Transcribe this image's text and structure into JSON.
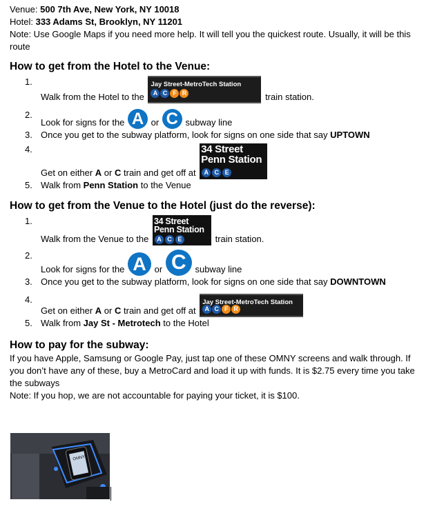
{
  "venue_label": "Venue:",
  "venue_value": "500 7th Ave, New York, NY 10018",
  "hotel_label": "Hotel:",
  "hotel_value": "333 Adams St, Brooklyn, NY 11201",
  "note_intro": "Note: Use Google Maps if you need more help. It will tell you the quickest route. Usually, it will be this route",
  "section1": {
    "heading": "How to get from the Hotel to the Venue:",
    "items": [
      {
        "num": "1.",
        "before": "Walk from the Hotel to the",
        "after": "train station."
      },
      {
        "num": "2.",
        "before": "Look for signs for the",
        "mid": "or",
        "after": "subway line"
      },
      {
        "num": "3.",
        "before": "Once you get to the subway platform, look for signs on one side that say",
        "bold": "UPTOWN"
      },
      {
        "num": "4.",
        "before": "Get on either",
        "bold1": "A",
        "mid": "or",
        "bold2": "C",
        "after": "train and get off at"
      },
      {
        "num": "5.",
        "before": "Walk from",
        "bold": "Penn Station",
        "after": "to the Venue"
      }
    ]
  },
  "section2": {
    "heading": "How to get from the Venue to the Hotel (just do the reverse):",
    "items": [
      {
        "num": "1.",
        "before": "Walk from the Venue to the",
        "after": "train station."
      },
      {
        "num": "2.",
        "before": "Look for signs for the",
        "mid": "or",
        "after": "subway line"
      },
      {
        "num": "3.",
        "before": "Once you get to the subway platform, look for signs on one side that say",
        "bold": "DOWNTOWN"
      },
      {
        "num": "4.",
        "before": "Get on either",
        "bold1": "A",
        "mid": "or",
        "bold2": "C",
        "after": "train and get off at"
      },
      {
        "num": "5.",
        "before": "Walk from",
        "bold": "Jay St - Metrotech",
        "after": "to the Hotel"
      }
    ]
  },
  "section3": {
    "heading": "How to pay for the subway:",
    "para": "If you have Apple, Samsung or Google Pay, just tap one of these OMNY screens and walk through. If you don’t have any of these, buy a MetroCard and load it up with funds. It is $2.75 every time you take the subways",
    "note": "Note: If you hop, we are not accountable for paying your ticket, it is $100."
  },
  "signs": {
    "jay_name": "Jay Street-MetroTech Station",
    "jay_lines": [
      "A",
      "C",
      "F",
      "R"
    ],
    "penn_line1": "34 Street",
    "penn_line2": "Penn Station",
    "penn_lines": [
      "A",
      "C",
      "E"
    ],
    "line_a": "A",
    "line_c": "C",
    "omny_label": "OMNY"
  },
  "colors": {
    "mta_blue": "#0f74c4",
    "ace_blue": "#1e5aa8",
    "fr_orange": "#f28c1a"
  }
}
